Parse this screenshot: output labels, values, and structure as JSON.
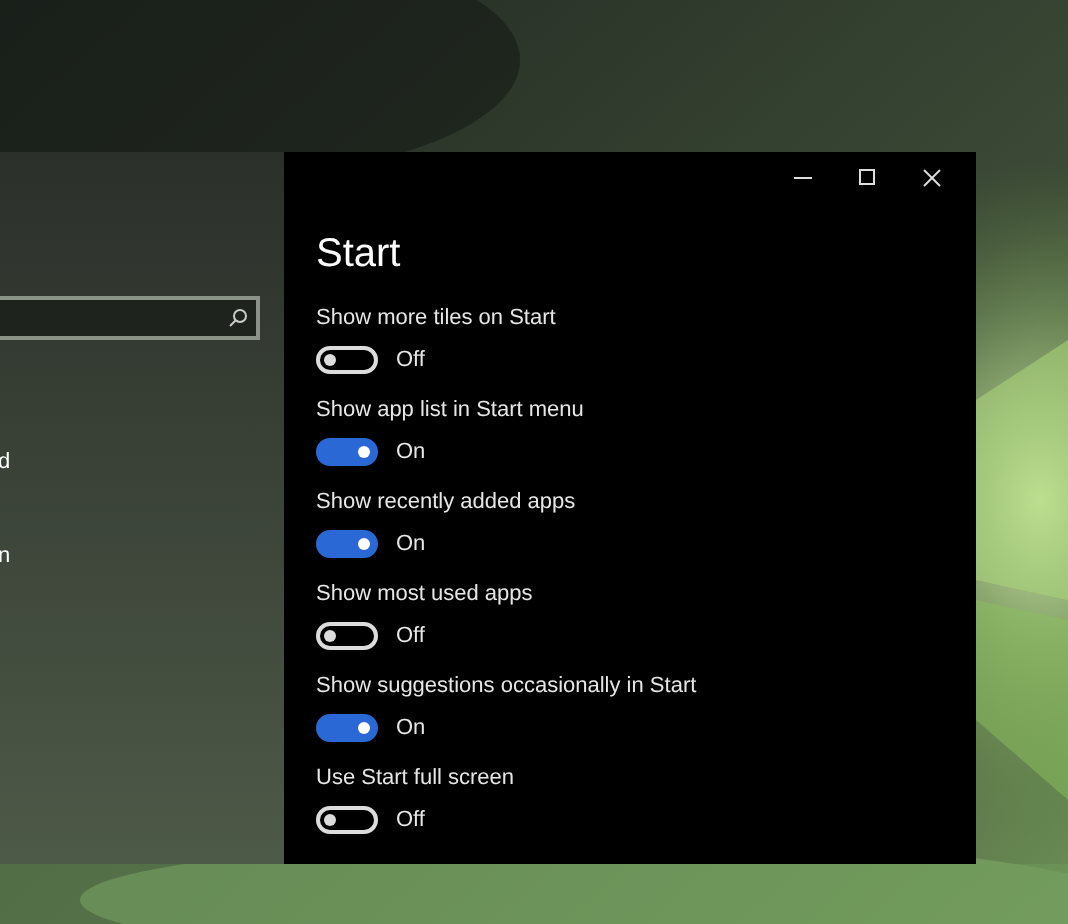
{
  "window": {
    "controls": [
      {
        "kind": "minimize"
      },
      {
        "kind": "maximize"
      },
      {
        "kind": "close"
      }
    ]
  },
  "sidebar": {
    "search": {
      "kind": "search"
    },
    "items": [
      {
        "label": "d"
      },
      {
        "label": "n"
      }
    ]
  },
  "page": {
    "title": "Start",
    "settings": [
      {
        "label": "Show more tiles on Start",
        "on": false,
        "state_text": "Off"
      },
      {
        "label": "Show app list in Start menu",
        "on": true,
        "state_text": "On"
      },
      {
        "label": "Show recently added apps",
        "on": true,
        "state_text": "On"
      },
      {
        "label": "Show most used apps",
        "on": false,
        "state_text": "Off"
      },
      {
        "label": "Show suggestions occasionally in Start",
        "on": true,
        "state_text": "On"
      },
      {
        "label": "Use Start full screen",
        "on": false,
        "state_text": "Off"
      }
    ]
  }
}
